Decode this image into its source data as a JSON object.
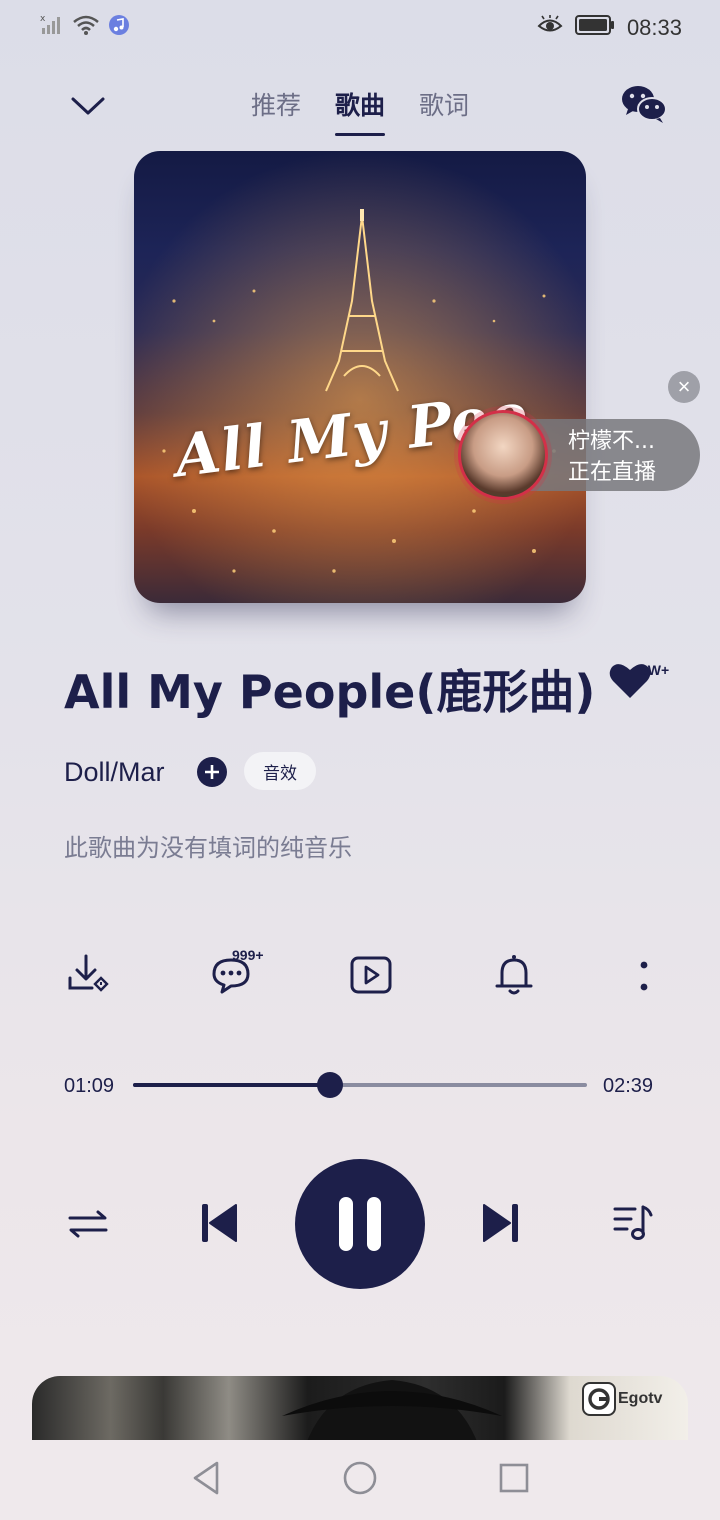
{
  "status_bar": {
    "time": "08:33",
    "icons": [
      "signal-icon",
      "wifi-icon",
      "music-app-icon",
      "eye-icon",
      "battery-icon"
    ]
  },
  "header": {
    "tabs": [
      {
        "label": "推荐",
        "active": false
      },
      {
        "label": "歌曲",
        "active": true
      },
      {
        "label": "歌词",
        "active": false
      }
    ]
  },
  "cover": {
    "title_text": "All My Peo"
  },
  "live": {
    "name": "柠檬不...",
    "status": "正在直播"
  },
  "song": {
    "title": "All My People(鹿形曲)",
    "artist": "Doll/Mar",
    "effect_label": "音效",
    "lyric_note": "此歌曲为没有填词的纯音乐",
    "like_count": "9W+",
    "comment_count": "999+"
  },
  "progress": {
    "elapsed": "01:09",
    "total": "02:39",
    "fraction": 0.434
  },
  "video": {
    "logo": "Egotv"
  },
  "colors": {
    "primary": "#1d1f4a",
    "live_ring": "#d33048",
    "secondary_text": "#7a7c92"
  }
}
